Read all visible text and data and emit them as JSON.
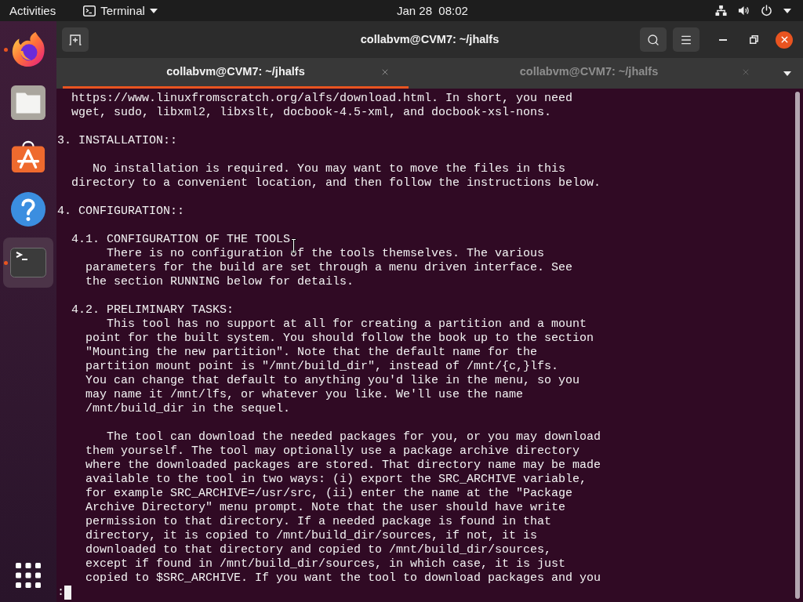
{
  "top_bar": {
    "activities": "Activities",
    "app_menu": "Terminal",
    "clock": "Jan 28  08:02"
  },
  "dock": {
    "items": [
      {
        "kind": "browser",
        "running": true,
        "selected": false
      },
      {
        "kind": "files",
        "running": false,
        "selected": false
      },
      {
        "kind": "store",
        "running": false,
        "selected": false
      },
      {
        "kind": "help",
        "running": false,
        "selected": false
      },
      {
        "kind": "terminal",
        "running": true,
        "selected": true
      }
    ]
  },
  "window": {
    "title": "collabvm@CVM7: ~/jhalfs",
    "tabs": [
      {
        "label": "collabvm@CVM7: ~/jhalfs",
        "selected": true
      },
      {
        "label": "collabvm@CVM7: ~/jhalfs",
        "selected": false
      }
    ]
  },
  "terminal": {
    "blocks": [
      [
        "  https://www.linuxfromscratch.org/alfs/download.html. In short, you need",
        "  wget, sudo, libxml2, libxslt, docbook-4.5-xml, and docbook-xsl-nons."
      ],
      [
        "3. INSTALLATION::"
      ],
      [
        "     No installation is required. You may want to move the files in this",
        "  directory to a convenient location, and then follow the instructions below."
      ],
      [
        "4. CONFIGURATION::"
      ],
      [
        "  4.1. CONFIGURATION OF THE TOOLS",
        "       There is no configuration of the tools themselves. The various",
        "    parameters for the build are set through a menu driven interface. See",
        "    the section RUNNING below for details."
      ],
      [
        "  4.2. PRELIMINARY TASKS:",
        "       This tool has no support at all for creating a partition and a mount",
        "    point for the built system. You should follow the book up to the section",
        "    \"Mounting the new partition\". Note that the default name for the",
        "    partition mount point is \"/mnt/build_dir\", instead of /mnt/{c,}lfs.",
        "    You can change that default to anything you'd like in the menu, so you",
        "    may name it /mnt/lfs, or whatever you like. We'll use the name",
        "    /mnt/build_dir in the sequel."
      ],
      [
        "       The tool can download the needed packages for you, or you may download",
        "    them yourself. The tool may optionally use a package archive directory",
        "    where the downloaded packages are stored. That directory name may be made",
        "    available to the tool in two ways: (i) export the SRC_ARCHIVE variable,",
        "    for example SRC_ARCHIVE=/usr/src, (ii) enter the name at the \"Package",
        "    Archive Directory\" menu prompt. Note that the user should have write",
        "    permission to that directory. If a needed package is found in that",
        "    directory, it is copied to /mnt/build_dir/sources, if not, it is",
        "    downloaded to that directory and copied to /mnt/build_dir/sources,",
        "    except if found in /mnt/build_dir/sources, in which case, it is just",
        "    copied to $SRC_ARCHIVE. If you want the tool to download packages and you"
      ]
    ],
    "prompt": ":"
  }
}
